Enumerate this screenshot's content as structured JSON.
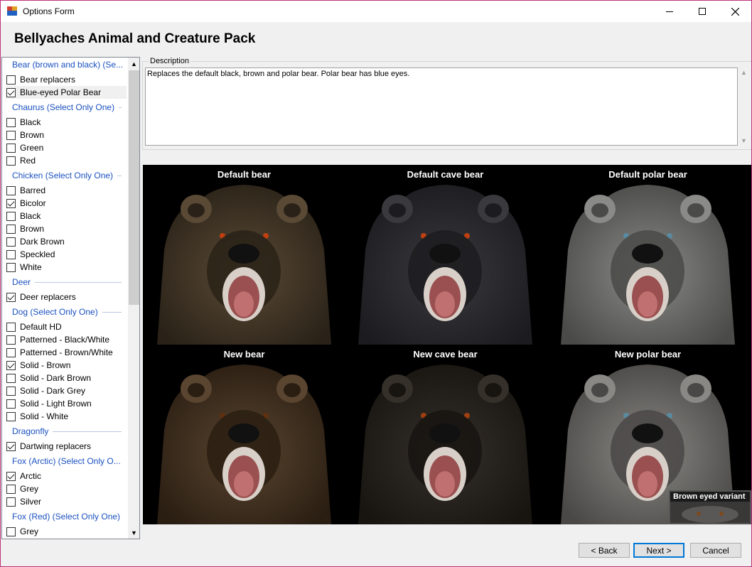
{
  "window": {
    "title": "Options Form",
    "icons": {
      "app": "app-icon",
      "minimize": "minimize-icon",
      "maximize": "maximize-icon",
      "close": "close-icon"
    }
  },
  "header": {
    "title": "Bellyaches Animal and Creature Pack"
  },
  "options": {
    "groups": [
      {
        "title": "Bear (brown and black) (Se...",
        "items": [
          {
            "label": "Bear replacers",
            "checked": false
          },
          {
            "label": "Blue-eyed Polar Bear",
            "checked": true,
            "selected": true
          }
        ]
      },
      {
        "title": "Chaurus (Select Only One)",
        "items": [
          {
            "label": "Black",
            "checked": false
          },
          {
            "label": "Brown",
            "checked": false
          },
          {
            "label": "Green",
            "checked": false
          },
          {
            "label": "Red",
            "checked": false
          }
        ]
      },
      {
        "title": "Chicken (Select Only One)",
        "items": [
          {
            "label": "Barred",
            "checked": false
          },
          {
            "label": "Bicolor",
            "checked": true
          },
          {
            "label": "Black",
            "checked": false
          },
          {
            "label": "Brown",
            "checked": false
          },
          {
            "label": "Dark Brown",
            "checked": false
          },
          {
            "label": "Speckled",
            "checked": false
          },
          {
            "label": "White",
            "checked": false
          }
        ]
      },
      {
        "title": "Deer",
        "items": [
          {
            "label": "Deer replacers",
            "checked": true
          }
        ]
      },
      {
        "title": "Dog (Select Only One)",
        "items": [
          {
            "label": "Default HD",
            "checked": false
          },
          {
            "label": "Patterned - Black/White",
            "checked": false
          },
          {
            "label": "Patterned - Brown/White",
            "checked": false
          },
          {
            "label": "Solid - Brown",
            "checked": true
          },
          {
            "label": "Solid - Dark Brown",
            "checked": false
          },
          {
            "label": "Solid - Dark Grey",
            "checked": false
          },
          {
            "label": "Solid - Light Brown",
            "checked": false
          },
          {
            "label": "Solid - White",
            "checked": false
          }
        ]
      },
      {
        "title": "Dragonfly",
        "items": [
          {
            "label": "Dartwing replacers",
            "checked": true
          }
        ]
      },
      {
        "title": "Fox (Arctic) (Select Only O...",
        "items": [
          {
            "label": "Arctic",
            "checked": true
          },
          {
            "label": "Grey",
            "checked": false
          },
          {
            "label": "Silver",
            "checked": false
          }
        ]
      },
      {
        "title": "Fox (Red) (Select Only One)",
        "items": [
          {
            "label": "Grey",
            "checked": false
          }
        ]
      }
    ]
  },
  "description": {
    "label": "Description",
    "text": "Replaces the default black, brown and polar bear. Polar bear has blue eyes."
  },
  "preview": {
    "tiles": [
      {
        "caption": "Default bear",
        "fur": "#5a4a35",
        "dark": "#2a2218",
        "eye": "#c04010"
      },
      {
        "caption": "Default cave bear",
        "fur": "#3a3a3e",
        "dark": "#1c1c20",
        "eye": "#c04010"
      },
      {
        "caption": "Default polar bear",
        "fur": "#8a8a88",
        "dark": "#4a4a48",
        "eye": "#5a8aa0"
      },
      {
        "caption": "New bear",
        "fur": "#5a4530",
        "dark": "#2a1e12",
        "eye": "#603010"
      },
      {
        "caption": "New cave bear",
        "fur": "#35302a",
        "dark": "#181410",
        "eye": "#a04010"
      },
      {
        "caption": "New polar bear",
        "fur": "#8a8884",
        "dark": "#4a4846",
        "eye": "#5a8aa0"
      }
    ],
    "variant_label": "Brown eyed variant"
  },
  "buttons": {
    "back": "< Back",
    "next": "Next >",
    "cancel": "Cancel"
  }
}
